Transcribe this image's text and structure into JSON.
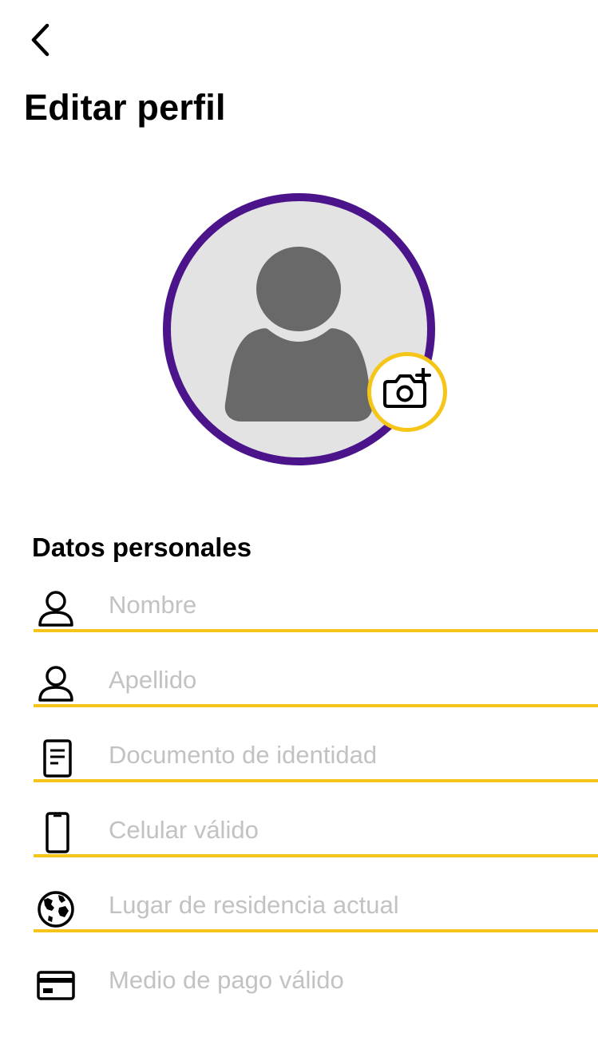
{
  "header": {
    "back_icon": "chevron-left-icon",
    "title": "Editar perfil"
  },
  "avatar": {
    "placeholder_icon": "user-silhouette-icon",
    "ring_color": "#4b148a",
    "background_color": "#e3e3e3",
    "camera_icon": "camera-plus-icon",
    "camera_ring_color": "#f5c518"
  },
  "personal_data": {
    "title": "Datos personales",
    "accent_color": "#f5c51c",
    "fields": [
      {
        "icon": "person-icon",
        "placeholder": "Nombre",
        "value": ""
      },
      {
        "icon": "person-icon",
        "placeholder": "Apellido",
        "value": ""
      },
      {
        "icon": "document-icon",
        "placeholder": "Documento de identidad",
        "value": ""
      },
      {
        "icon": "mobile-phone-icon",
        "placeholder": "Celular válido",
        "value": ""
      },
      {
        "icon": "globe-icon",
        "placeholder": "Lugar de residencia actual",
        "value": ""
      },
      {
        "icon": "credit-card-icon",
        "placeholder": "Medio de pago válido",
        "value": ""
      }
    ]
  }
}
